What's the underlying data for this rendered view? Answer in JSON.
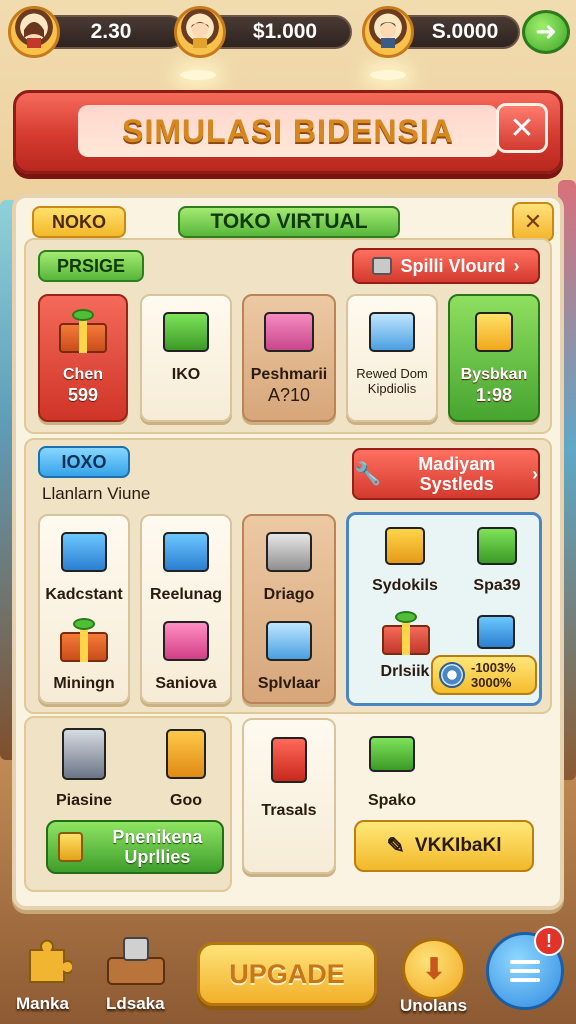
{
  "topbar": {
    "stat1": "2.30",
    "stat2": "$1.000",
    "stat3": "S.0000"
  },
  "title": {
    "text": "SIMULASI BIDENSIA"
  },
  "panel": {
    "tag_noko": "NOKO",
    "tab_toko_virtual": "TOKO VIRTUAL",
    "tag_prsige": "PRSIGE",
    "spill_button": "Spilli Vlourd",
    "top_cards": [
      {
        "name": "Chen",
        "value": "599"
      },
      {
        "name": "IKO",
        "value": ""
      },
      {
        "name": "Peshmarii",
        "value": "A?10"
      },
      {
        "name": "Rewed Dom Kipdiolis",
        "value": ""
      },
      {
        "name": "Bysbkan",
        "value": "1:98"
      }
    ],
    "tag_ioxo": "IOXO",
    "section_label": "Llanlarn Viune",
    "madiyam_button": "Madiyam Systleds",
    "middle_cards": [
      {
        "name": "Kadcstant"
      },
      {
        "name": "Reelunag"
      },
      {
        "name": "Driago"
      },
      {
        "name": "Miningn"
      },
      {
        "name": "Saniova"
      },
      {
        "name": "Splvlaar"
      }
    ],
    "info_items": [
      {
        "name": "Sydokils"
      },
      {
        "name": "Spa39"
      },
      {
        "name": "Drlsiik"
      }
    ],
    "info_stat_line1": "-1003%",
    "info_stat_line2": "3000%",
    "bottom_cards": [
      {
        "name": "Piasine"
      },
      {
        "name": "Goo"
      },
      {
        "name": "Trasals"
      },
      {
        "name": "Spako"
      }
    ],
    "green_button": "Pnenikena Uprllies",
    "yellow_button": "VKKIbaKl"
  },
  "bottom_bar": {
    "left1": "Manka",
    "left2": "Ldsaka",
    "upgrade": "UPGADE",
    "right1": "Unolans",
    "badge": "!"
  },
  "colors": {
    "title_red": "#d63b30",
    "panel_bg": "#fbf3e2",
    "accent_green": "#46a530",
    "accent_yellow": "#f3b92c",
    "accent_blue": "#36a3e8"
  }
}
